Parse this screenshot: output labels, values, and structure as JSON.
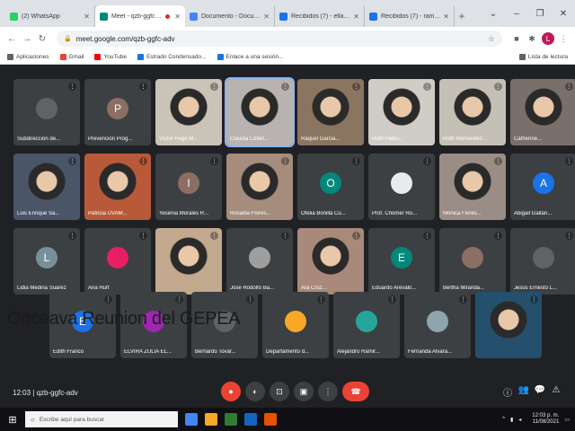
{
  "browser": {
    "tabs": [
      {
        "title": "(2) WhatsApp",
        "favicon_color": "#25d366",
        "active": false
      },
      {
        "title": "Meet - qzb-ggfc-adv",
        "favicon_color": "#00897b",
        "active": true,
        "recording": true
      },
      {
        "title": "Documento - Docum...",
        "favicon_color": "#4285f4",
        "active": false
      },
      {
        "title": "Recibidos (7) - ellacrupo...",
        "favicon_color": "#1a73e8",
        "active": false
      },
      {
        "title": "Recibidos (7) - ramurai...",
        "favicon_color": "#1a73e8",
        "active": false
      }
    ],
    "new_tab": "+",
    "window_controls": [
      "⌄",
      "–",
      "❐",
      "✕"
    ],
    "nav": [
      "←",
      "→",
      "↻"
    ],
    "url": "meet.google.com/qzb-ggfc-adv",
    "bookmarks": [
      {
        "label": "Aplicaciones",
        "color": "#5f6368"
      },
      {
        "label": "Gmail",
        "color": "#ea4335"
      },
      {
        "label": "YouTube",
        "color": "#ff0000"
      },
      {
        "label": "Estrado Condensado...",
        "color": "#1a73e8"
      },
      {
        "label": "Enlace a una sesión...",
        "color": "#1a73e8"
      }
    ],
    "reading_list": "Lista de lectura",
    "profile_initial": "L"
  },
  "meet": {
    "overlay_title": "Onceava Reunion del GEPEA",
    "participants": [
      {
        "name": "Subdirección de...",
        "avatar": "",
        "avatar_color": "#5f6368",
        "kind": "avatar"
      },
      {
        "name": "Prevención Prog...",
        "avatar": "P",
        "avatar_color": "#8d6e63",
        "kind": "avatar"
      },
      {
        "name": "Víctor Hugo M...",
        "avatar": "",
        "avatar_color": "",
        "kind": "photo",
        "bg": "#c9c3b8"
      },
      {
        "name": "Claudia Lizbet...",
        "avatar": "",
        "avatar_color": "",
        "kind": "photo",
        "bg": "#b8b3b0",
        "highlight": true
      },
      {
        "name": "Raquel Garcia...",
        "avatar": "",
        "avatar_color": "",
        "kind": "photo",
        "bg": "#8a7560"
      },
      {
        "name": "Ruth Pablo...",
        "avatar": "",
        "avatar_color": "",
        "kind": "photo",
        "bg": "#d0ccc6"
      },
      {
        "name": "Ruth Hernández...",
        "avatar": "",
        "avatar_color": "",
        "kind": "photo",
        "bg": "#c4c0b6"
      },
      {
        "name": "Catherine...",
        "avatar": "",
        "avatar_color": "",
        "kind": "photo",
        "bg": "#7a6f6a"
      },
      {
        "name": "Luis Enrique Sa...",
        "avatar": "",
        "avatar_color": "",
        "kind": "photo",
        "bg": "#4a5568"
      },
      {
        "name": "Patricia UVAM...",
        "avatar": "",
        "avatar_color": "",
        "kind": "photo",
        "bg": "#b85a3a"
      },
      {
        "name": "Yesenia Morales R...",
        "avatar": "I",
        "avatar_color": "#8d6e63",
        "kind": "avatar"
      },
      {
        "name": "Rosalba Flores...",
        "avatar": "",
        "avatar_color": "",
        "kind": "photo",
        "bg": "#a58c7c"
      },
      {
        "name": "Ofelia Bonilla Cu...",
        "avatar": "O",
        "avatar_color": "#00897b",
        "kind": "avatar"
      },
      {
        "name": "Prof. Chomer Ro...",
        "avatar": "",
        "avatar_color": "#e8eaed",
        "kind": "avatar"
      },
      {
        "name": "Mónica Flores...",
        "avatar": "",
        "avatar_color": "",
        "kind": "photo",
        "bg": "#9a8d85"
      },
      {
        "name": "Abigail Gaitan...",
        "avatar": "A",
        "avatar_color": "#1a73e8",
        "kind": "avatar"
      },
      {
        "name": "Lidia Medina Suarez",
        "avatar": "L",
        "avatar_color": "#78909c",
        "kind": "avatar"
      },
      {
        "name": "Ana Hurt",
        "avatar": "",
        "avatar_color": "#e91e63",
        "kind": "avatar"
      },
      {
        "name": "",
        "avatar": "",
        "avatar_color": "",
        "kind": "photo",
        "bg": "#c2a98e"
      },
      {
        "name": "José Rodolfo Ba...",
        "avatar": "",
        "avatar_color": "#9e9e9e",
        "kind": "avatar"
      },
      {
        "name": "Ara Cruz...",
        "avatar": "",
        "avatar_color": "",
        "kind": "photo",
        "bg": "#a9897a"
      },
      {
        "name": "Eduardo Arevalo...",
        "avatar": "E",
        "avatar_color": "#00897b",
        "kind": "avatar"
      },
      {
        "name": "Bertha Miranda...",
        "avatar": "",
        "avatar_color": "#8d6e63",
        "kind": "avatar"
      },
      {
        "name": "Jesús Ernesto L...",
        "avatar": "",
        "avatar_color": "#5f6368",
        "kind": "avatar"
      },
      {
        "name": "Edith Franco",
        "avatar": "E",
        "avatar_color": "#1a73e8",
        "kind": "avatar"
      },
      {
        "name": "ELVIRA ZULIA EL...",
        "avatar": "",
        "avatar_color": "#9c27b0",
        "kind": "avatar"
      },
      {
        "name": "Bernardo Tovar...",
        "avatar": "",
        "avatar_color": "#5f6368",
        "kind": "avatar"
      },
      {
        "name": "Departamento d...",
        "avatar": "",
        "avatar_color": "#f9a825",
        "kind": "avatar"
      },
      {
        "name": "Alejandro Ramir...",
        "avatar": "",
        "avatar_color": "#26a69a",
        "kind": "avatar"
      },
      {
        "name": "Fernanda Alvara...",
        "avatar": "",
        "avatar_color": "#90a4ae",
        "kind": "avatar"
      },
      {
        "name": "",
        "avatar": "",
        "avatar_color": "",
        "kind": "photo",
        "bg": "#24506e"
      }
    ],
    "controls": {
      "time": "12:03",
      "meeting_code": "qzb-ggfc-adv",
      "mic": "●",
      "camera": "◐",
      "captions": "⊡",
      "present": "▣",
      "more": "⋮",
      "end_call": "☎",
      "right_icons": [
        "ⓘ",
        "👥",
        "💬",
        "⚠"
      ]
    }
  },
  "taskbar": {
    "start": "⊞",
    "search_placeholder": "Escribe aquí para buscar",
    "apps": [
      "#4285f4",
      "#f9a825",
      "#2e7d32",
      "#1565c0",
      "#e65100"
    ],
    "tray": {
      "up": "^",
      "time": "12:03 p. m.",
      "date": "11/08/2021"
    }
  }
}
